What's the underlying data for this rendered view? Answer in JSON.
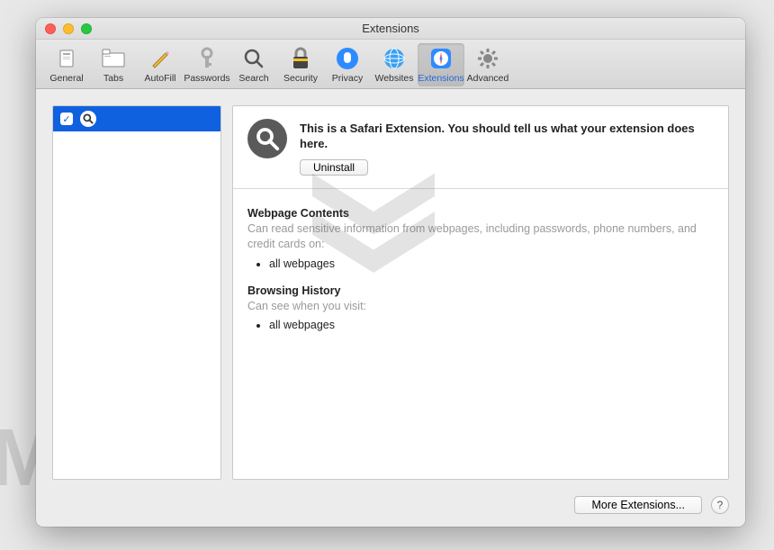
{
  "window": {
    "title": "Extensions"
  },
  "toolbar": {
    "items": [
      {
        "label": "General"
      },
      {
        "label": "Tabs"
      },
      {
        "label": "AutoFill"
      },
      {
        "label": "Passwords"
      },
      {
        "label": "Search"
      },
      {
        "label": "Security"
      },
      {
        "label": "Privacy"
      },
      {
        "label": "Websites"
      },
      {
        "label": "Extensions"
      },
      {
        "label": "Advanced"
      }
    ]
  },
  "sidebar": {
    "selected_extension_icon": "search-icon"
  },
  "detail": {
    "description": "This is a Safari Extension. You should tell us what your extension does here.",
    "uninstall_label": "Uninstall",
    "permissions": [
      {
        "heading": "Webpage Contents",
        "description": "Can read sensitive information from webpages, including passwords, phone numbers, and credit cards on:",
        "items": [
          "all webpages"
        ]
      },
      {
        "heading": "Browsing History",
        "description": "Can see when you visit:",
        "items": [
          "all webpages"
        ]
      }
    ]
  },
  "footer": {
    "more_label": "More Extensions...",
    "help_label": "?"
  },
  "watermark": "MALWARETIPS"
}
